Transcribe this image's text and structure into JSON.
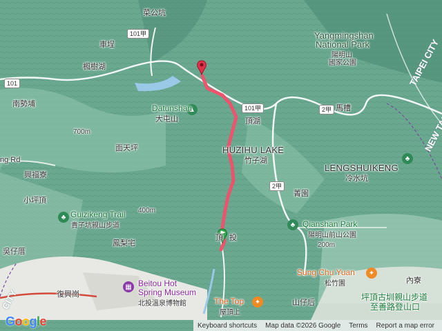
{
  "map": {
    "provider": "Google",
    "colors": {
      "terrain": "#5d9c86",
      "route": "#f0506a",
      "water": "#9ac9e8",
      "road": "#ffffff"
    }
  },
  "labels": {
    "caigongkeng": "菜公坑",
    "chepu": "車埕",
    "fengshuhu": "楓樹湖",
    "nanshibu": "南勢埔",
    "datunshan_en": "Datunshan",
    "datunshan_zh": "大屯山",
    "dinghu": "頂湖",
    "miantianping": "面天坪",
    "xingfuliao": "興福寮",
    "xiaopingding": "小坪頂",
    "wuzicuo": "吳仔厝",
    "fengliezhai": "鳳梨宅",
    "ng_rd": "ng Rd",
    "huzihu_en": "HUZIHU LAKE",
    "huzihu_zh": "竹子湖",
    "yangmingshan_en_1": "Yangmingshan",
    "yangmingshan_en_2": "National Park",
    "yangmingshan_zh_1": "陽明山",
    "yangmingshan_zh_2": "國家公園",
    "macao": "馬槽",
    "lengshuikeng_en": "LENGSHUIKENG",
    "lengshuikeng_zh": "冷水坑",
    "junyuan": "菁園",
    "qianshan_en": "Qianshan Park",
    "qianshan_zh": "陽明山前山公園",
    "guizikeng_en": "Guizikeng Trail",
    "guizikeng_zh": "貴子坑親山步道",
    "dingtou": "頂",
    "dingtou2": "投",
    "sungchu_en": "Sung Chu Yuan",
    "sungchu_zh": "松竹園",
    "neicuo": "內寮",
    "beitou_en_1": "Beitou Hot",
    "beitou_en_2": "Spring Museum",
    "beitou_zh": "北投溫泉博物館",
    "thetop_en": "The Top",
    "thetop_zh": "屋頂上",
    "shanzihou": "山仔后",
    "fuxinggang": "復興崗",
    "pingding_1": "坪頂古圳親山步道",
    "pingding_2": "至善路登山口",
    "taipei_city": "TAIPEI CITY",
    "new_taipei": "NEW TAI",
    "city_edge": "CITY"
  },
  "shields": {
    "r101a_top": "101甲",
    "r101": "101",
    "r101a_mid": "101甲",
    "r2a": "2甲",
    "r2b": "2甲"
  },
  "elevation": {
    "e700": "700m",
    "e400": "400m",
    "e200": "200m"
  },
  "footer": {
    "logo": "Google",
    "shortcuts": "Keyboard shortcuts",
    "data": "Map data ©2026 Google",
    "terms": "Terms",
    "report": "Report a map error"
  }
}
